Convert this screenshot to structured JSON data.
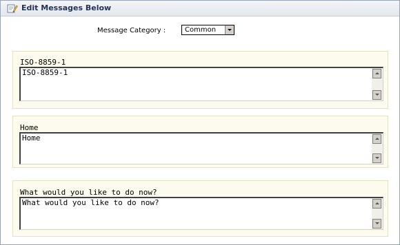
{
  "header": {
    "title": "Edit Messages Below",
    "icon": "edit-pencil-icon"
  },
  "category": {
    "label": "Message Category :",
    "selected": "Common"
  },
  "messages": [
    {
      "label": "ISO-8859-1",
      "value": "ISO-8859-1"
    },
    {
      "label": "Home",
      "value": "Home"
    },
    {
      "label": "What would you like to do now?",
      "value": "What would you like to do now?"
    }
  ],
  "colors": {
    "block_background": "#fcfbee",
    "header_title": "#223355",
    "panel_border": "#9aa3b5"
  }
}
